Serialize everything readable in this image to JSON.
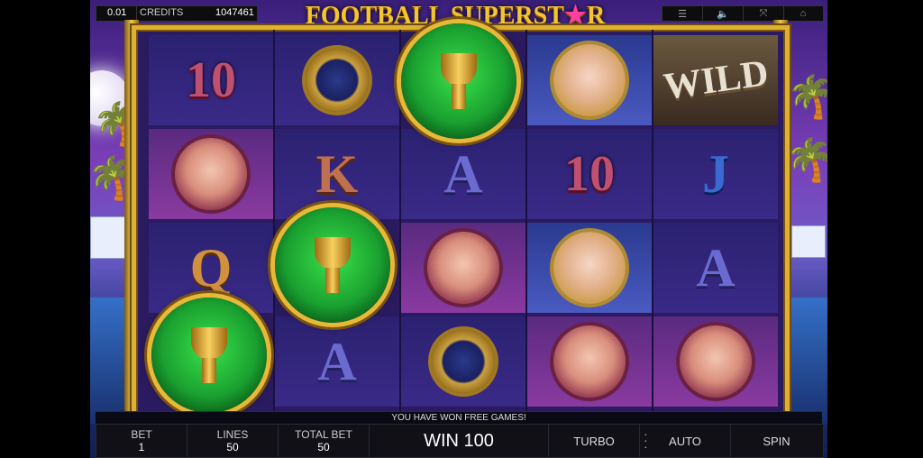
{
  "topbar": {
    "denomination": "0.01",
    "credits_label": "CREDITS",
    "credits_value": "1047461"
  },
  "icons": [
    "menu-icon",
    "volume-icon",
    "fullscreen-icon",
    "home-icon"
  ],
  "title": {
    "part1": "FOOTBALL SUPERST",
    "star": "★",
    "part2": "R"
  },
  "reels": [
    [
      "10",
      "girl",
      "Q"
    ],
    [
      "watch",
      "K",
      "A"
    ],
    [
      "A",
      "girl",
      "watch"
    ],
    [
      "girl-blonde",
      "10",
      "girl-blonde",
      "girl"
    ],
    [
      "WILD",
      "J",
      "A",
      "girl"
    ]
  ],
  "symbols": {
    "ten": "10",
    "king": "K",
    "ace": "A",
    "queen": "Q",
    "jack": "J",
    "wild": "WILD"
  },
  "status_message": "YOU HAVE WON FREE GAMES!",
  "controls": {
    "bet_label": "BET",
    "bet_value": "1",
    "lines_label": "LINES",
    "lines_value": "50",
    "total_bet_label": "TOTAL BET",
    "total_bet_value": "50",
    "win_text": "WIN 100",
    "turbo_label": "TURBO",
    "auto_label": "AUTO",
    "spin_label": "SPIN"
  },
  "colors": {
    "frame_gold": "#e0b030",
    "trophy_green": "#1aa030"
  }
}
